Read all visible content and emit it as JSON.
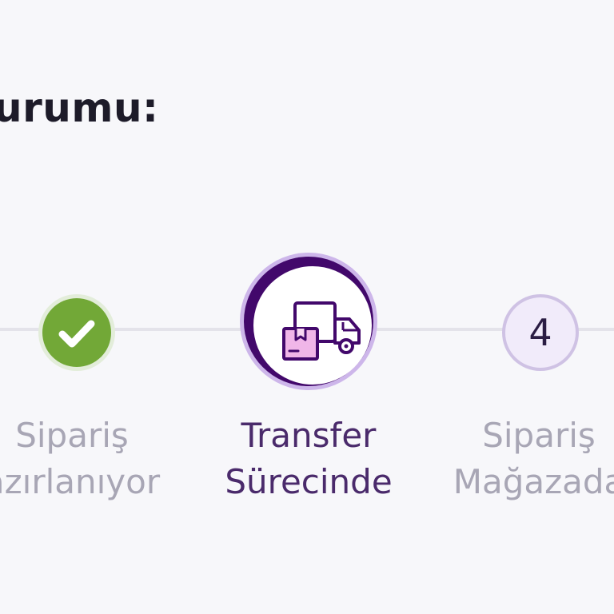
{
  "heading": "urumu:",
  "steps": [
    {
      "status": "completed",
      "icon": "checkmark-icon",
      "label_line1": "Sipariş",
      "label_line2": "azırlanıyor"
    },
    {
      "status": "active",
      "icon": "transfer-truck-icon",
      "label_line1": "Transfer",
      "label_line2": "Sürecinde"
    },
    {
      "status": "pending",
      "number": "4",
      "label_line1": "Sipariş",
      "label_line2": "Mağazada"
    }
  ],
  "colors": {
    "completed": "#72a837",
    "active": "#42086b",
    "pending_bg": "#f1ebfa",
    "muted_text": "#a8a6b5",
    "active_text": "#4a2a6b"
  }
}
